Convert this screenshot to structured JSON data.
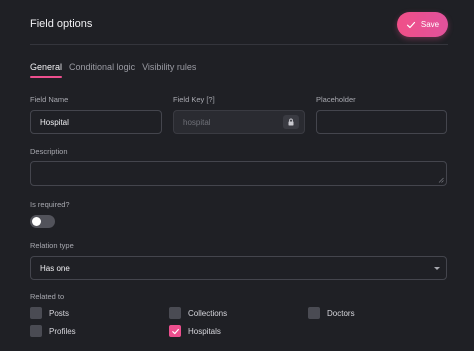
{
  "header": {
    "title": "Field options",
    "save_label": "Save"
  },
  "tabs": [
    {
      "label": "General",
      "active": true
    },
    {
      "label": "Conditional logic",
      "active": false
    },
    {
      "label": "Visibility rules",
      "active": false
    }
  ],
  "fields": {
    "field_name": {
      "label": "Field Name",
      "value": "Hospital"
    },
    "field_key": {
      "label": "Field Key [?]",
      "placeholder": "hospital"
    },
    "placeholder": {
      "label": "Placeholder",
      "value": ""
    },
    "description": {
      "label": "Description",
      "value": ""
    },
    "required": {
      "label": "Is required?",
      "on": false
    },
    "relation_type": {
      "label": "Relation type",
      "value": "Has one"
    }
  },
  "related_to": {
    "label": "Related to",
    "options": [
      {
        "label": "Posts",
        "checked": false
      },
      {
        "label": "Collections",
        "checked": false
      },
      {
        "label": "Doctors",
        "checked": false
      },
      {
        "label": "Profiles",
        "checked": false
      },
      {
        "label": "Hospitals",
        "checked": true
      }
    ]
  },
  "colors": {
    "accent": "#ec4f8e",
    "background": "#1f2025"
  }
}
